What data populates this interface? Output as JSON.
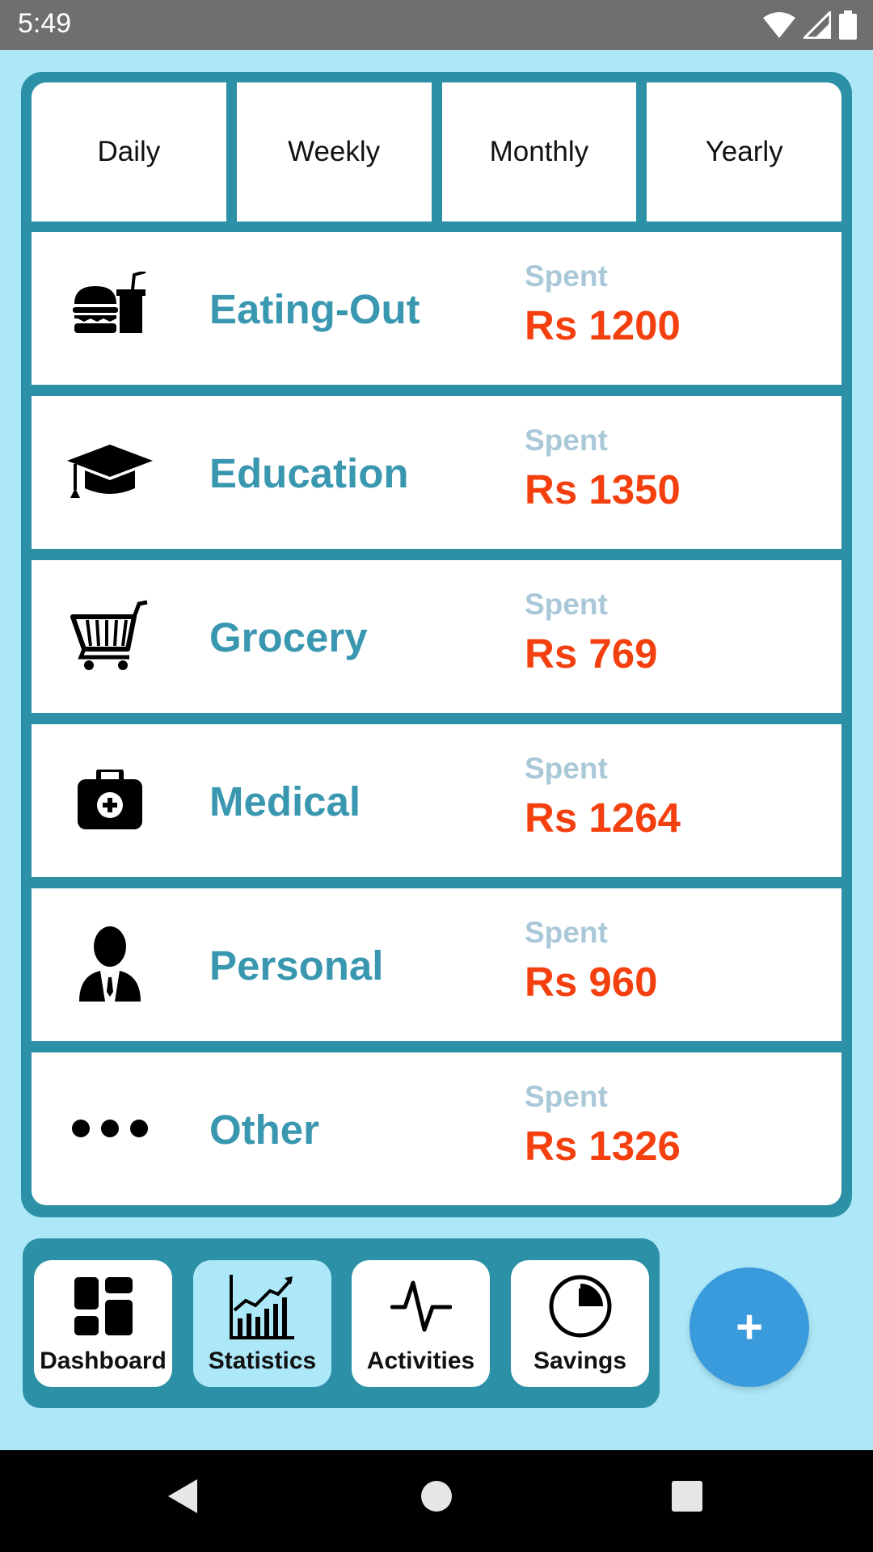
{
  "status_bar": {
    "time": "5:49"
  },
  "period_tabs": [
    "Daily",
    "Weekly",
    "Monthly",
    "Yearly"
  ],
  "spent_label": "Spent",
  "categories": [
    {
      "name": "Eating-Out",
      "amount": "Rs 1200",
      "icon": "fast-food-icon"
    },
    {
      "name": "Education",
      "amount": "Rs 1350",
      "icon": "graduation-cap-icon"
    },
    {
      "name": "Grocery",
      "amount": "Rs 769",
      "icon": "shopping-cart-icon"
    },
    {
      "name": "Medical",
      "amount": "Rs 1264",
      "icon": "medical-kit-icon"
    },
    {
      "name": "Personal",
      "amount": "Rs 960",
      "icon": "person-icon"
    },
    {
      "name": "Other",
      "amount": "Rs 1326",
      "icon": "more-dots-icon"
    }
  ],
  "bottom_nav": [
    {
      "label": "Dashboard",
      "icon": "dashboard-icon",
      "active": false
    },
    {
      "label": "Statistics",
      "icon": "statistics-icon",
      "active": true
    },
    {
      "label": "Activities",
      "icon": "activities-icon",
      "active": false
    },
    {
      "label": "Savings",
      "icon": "savings-icon",
      "active": false
    }
  ],
  "fab": {
    "glyph": "+"
  },
  "colors": {
    "background": "#ade8f8",
    "card_frame": "#2c90a6",
    "category_name": "#3a97b0",
    "spent_label": "#a9c8d8",
    "amount": "#f4400f",
    "fab": "#3a9bdc"
  }
}
